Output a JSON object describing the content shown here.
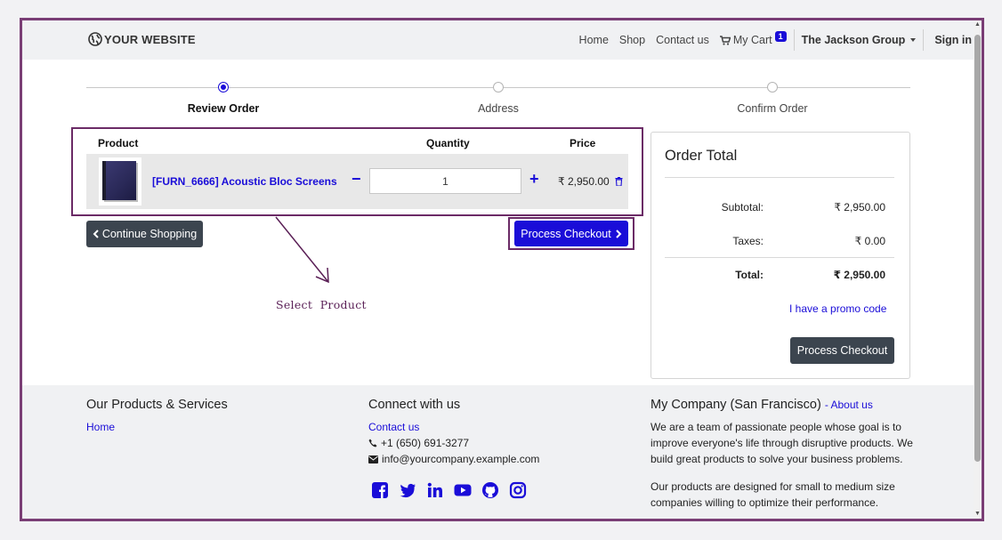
{
  "navbar": {
    "brand": "YOUR WEBSITE",
    "items": [
      "Home",
      "Shop",
      "Contact us"
    ],
    "cart_label": "My Cart",
    "cart_count": "1",
    "user": "The Jackson Group",
    "signin": "Sign in"
  },
  "steps": [
    "Review Order",
    "Address",
    "Confirm Order"
  ],
  "cart": {
    "headers": {
      "product": "Product",
      "quantity": "Quantity",
      "price": "Price"
    },
    "item": {
      "name": "[FURN_6666] Acoustic Bloc Screens",
      "quantity": "1",
      "price": "₹ 2,950.00"
    },
    "continue_label": "Continue Shopping",
    "checkout_label": "Process Checkout"
  },
  "annotation": "Select  Product",
  "order_total": {
    "title": "Order Total",
    "subtotal_label": "Subtotal:",
    "subtotal": "₹ 2,950.00",
    "taxes_label": "Taxes:",
    "taxes": "₹ 0.00",
    "total_label": "Total:",
    "total": "₹ 2,950.00",
    "promo": "I have a promo code",
    "checkout_label": "Process Checkout"
  },
  "footer": {
    "products_title": "Our Products & Services",
    "products_link": "Home",
    "connect_title": "Connect with us",
    "contact_link": "Contact us",
    "phone": "+1 (650) 691-3277",
    "email": "info@yourcompany.example.com",
    "company_title": "My Company (San Francisco)",
    "about_link": "About us",
    "about_p1": "We are a team of passionate people whose goal is to improve everyone's life through disruptive products. We build great products to solve your business problems.",
    "about_p2": "Our products are designed for small to medium size companies willing to optimize their performance."
  },
  "colors": {
    "primary": "#1a0dd8",
    "dark": "#3c454f",
    "annotation": "#6b2b66"
  }
}
